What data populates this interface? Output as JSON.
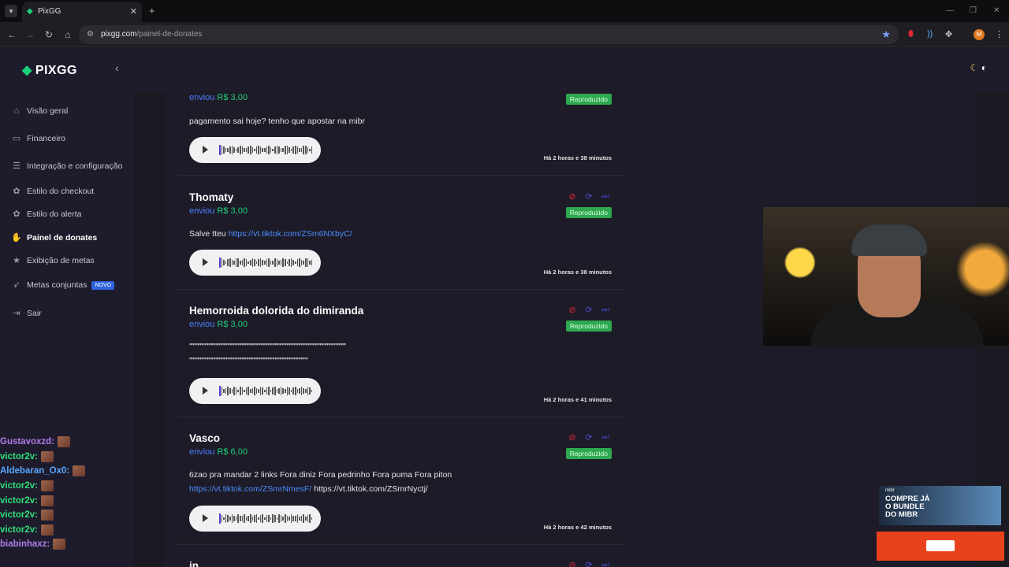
{
  "browser": {
    "tab_title": "PixGG",
    "url_domain": "pixgg.com",
    "url_path": "/painel-de-donates",
    "avatar_initial": "M"
  },
  "sidebar": {
    "logo": "PIXGG",
    "items": [
      {
        "label": "Visão geral",
        "icon": "home-icon"
      },
      {
        "label": "Financeiro",
        "icon": "wallet-icon"
      },
      {
        "label": "Integração e configuração",
        "icon": "settings-icon"
      },
      {
        "label": "Estilo do checkout",
        "icon": "palette-icon"
      },
      {
        "label": "Estilo do alerta",
        "icon": "palette-icon"
      },
      {
        "label": "Painel de donates",
        "icon": "hand-coin-icon",
        "active": true
      },
      {
        "label": "Exibição de metas",
        "icon": "star-icon"
      },
      {
        "label": "Metas conjuntas",
        "icon": "rocket-icon",
        "badge": "NOVO"
      },
      {
        "label": "Sair",
        "icon": "logout-icon"
      }
    ]
  },
  "chat": [
    {
      "name": "Gustavoxzd:",
      "color": "#b07be8"
    },
    {
      "name": "victor2v:",
      "color": "#2fe07a"
    },
    {
      "name": "Aldebaran_Ox0:",
      "color": "#5aa7ff"
    },
    {
      "name": "victor2v:",
      "color": "#2fe07a"
    },
    {
      "name": "victor2v:",
      "color": "#2fe07a"
    },
    {
      "name": "victor2v:",
      "color": "#2fe07a"
    },
    {
      "name": "victor2v:",
      "color": "#2fe07a"
    },
    {
      "name": "biabinhaxz:",
      "color": "#b07be8"
    }
  ],
  "donations": [
    {
      "name": "",
      "sent_label": "enviou",
      "amount": "R$ 3,00",
      "status": "Reproduzido",
      "message": "pagamento sai hoje? tenho que apostar na mibr",
      "time": "Há 2 horas e 38 minutos"
    },
    {
      "name": "Thomaty",
      "sent_label": "enviou",
      "amount": "R$ 3,00",
      "status": "Reproduzido",
      "message": "Salve tteu",
      "link": "https://vt.tiktok.com/ZSm6NXbyC/",
      "time": "Há 2 horas e 38 minutos"
    },
    {
      "name": "Hemorroida dolorida do dimiranda",
      "sent_label": "enviou",
      "amount": "R$ 3,00",
      "status": "Reproduzido",
      "message": "''''''''''''''''''''''''''''''''''''''''''''''''''''''''''''''''''''''''''''''''''''''''''''''''''''''''''''''''''''''''''''''''''''",
      "message2": "''''''''''''''''''''''''''''''''''''''''''''''''''''''''''''''''''''''''''''''''''''''''''''''''''''",
      "time": "Há 2 horas e 41 minutos"
    },
    {
      "name": "Vasco",
      "sent_label": "enviou",
      "amount": "R$ 6,00",
      "status": "Reproduzido",
      "message": "6zao pra mandar 2 links Fora diniz Fora pedrinho Fora puma Fora piton",
      "link": "https://vt.tiktok.com/ZSmrNmesF/",
      "link2": "https://vt.tiktok.com/ZSmrNyctj/",
      "time": "Há 2 horas e 42 minutos"
    },
    {
      "name": "in"
    }
  ],
  "promo": {
    "brand": "mibr",
    "text": "COMPRE JÁ O BUNDLE DO MIBR"
  },
  "colors": {
    "accent_green": "#1fd17a",
    "link_blue": "#4a7dff",
    "status_green": "#2fa84f",
    "sidebar_bg": "#1d1b2c"
  }
}
